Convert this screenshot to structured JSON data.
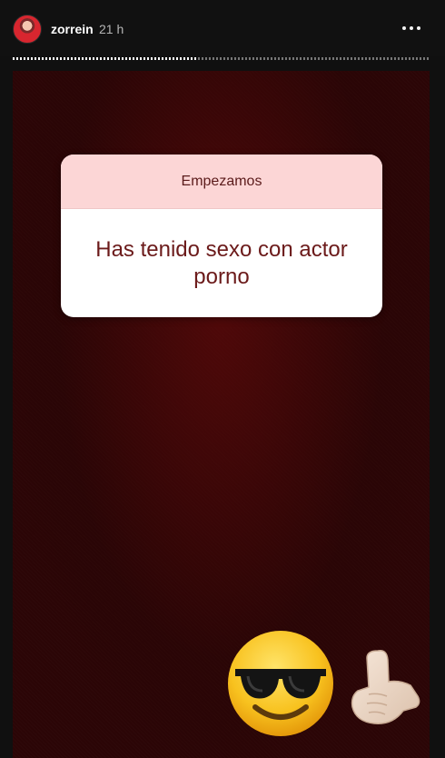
{
  "header": {
    "username": "zorrein",
    "time_ago": "21 h",
    "progress_fraction": 0.44
  },
  "story": {
    "question_box": {
      "title": "Empezamos",
      "text": "Has tenido sexo con actor porno"
    },
    "stickers": [
      {
        "icon": "sunglasses-smiley-icon"
      },
      {
        "icon": "call-me-hand-icon"
      }
    ]
  },
  "colors": {
    "background": "#101010",
    "story_background": "#2b0506",
    "card_header": "#fcd6d6",
    "card_text": "#6b1a1a"
  }
}
